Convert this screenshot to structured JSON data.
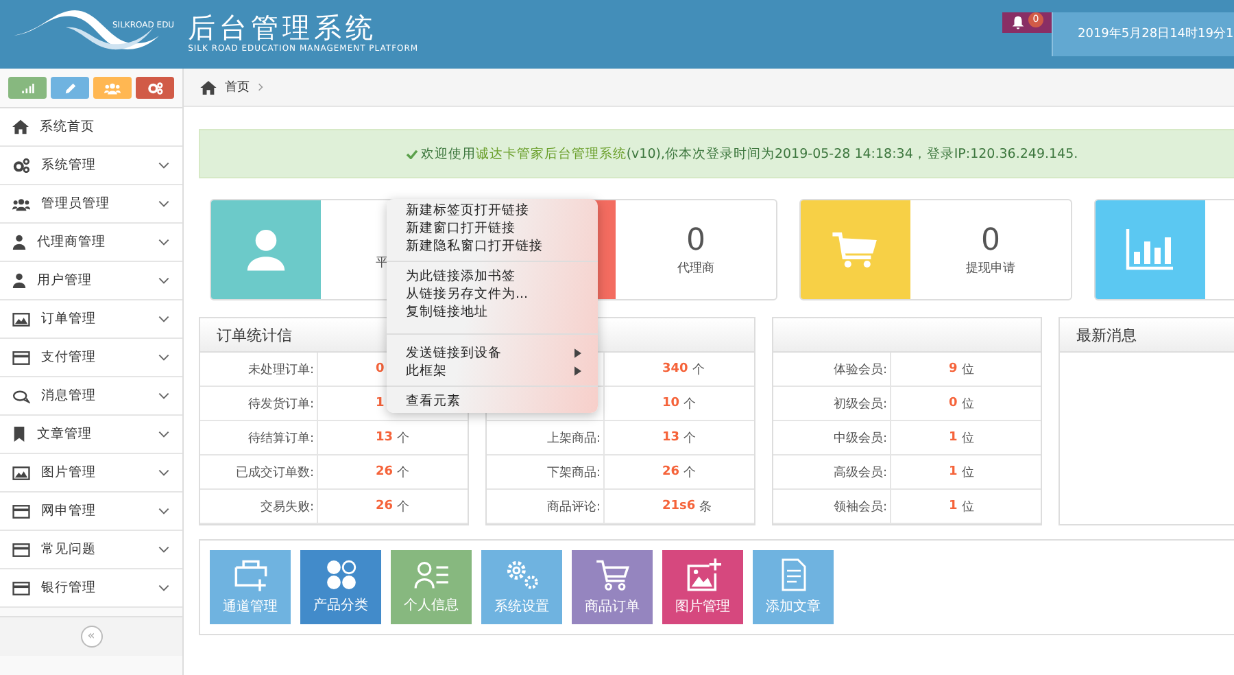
{
  "header": {
    "logo_text": "SILKROAD EDU",
    "title": "后台管理系统",
    "subtitle": "SILK ROAD EDUCATION MANAGEMENT PLATFORM",
    "notifications": "0",
    "datetime": "2019年5月28日14时19分1"
  },
  "sidebar": {
    "shortcuts": [
      {
        "color": "#87b87f"
      },
      {
        "color": "#6fb3e0"
      },
      {
        "color": "#ffb752"
      },
      {
        "color": "#d15b47"
      }
    ],
    "items": [
      {
        "label": "系统首页",
        "expandable": false
      },
      {
        "label": "系统管理",
        "expandable": true
      },
      {
        "label": "管理员管理",
        "expandable": true
      },
      {
        "label": "代理商管理",
        "expandable": true
      },
      {
        "label": "用户管理",
        "expandable": true
      },
      {
        "label": "订单管理",
        "expandable": true
      },
      {
        "label": "支付管理",
        "expandable": true
      },
      {
        "label": "消息管理",
        "expandable": true
      },
      {
        "label": "文章管理",
        "expandable": true
      },
      {
        "label": "图片管理",
        "expandable": true
      },
      {
        "label": "网申管理",
        "expandable": true
      },
      {
        "label": "常见问题",
        "expandable": true
      },
      {
        "label": "银行管理",
        "expandable": true
      }
    ],
    "collapse": "«"
  },
  "breadcrumb": [
    "首页"
  ],
  "welcome": "欢迎使用**诚达卡管家后台管理系统**(v10),你本次登录时间为2019-05-28 14:18:34，登录IP:120.36.249.145.",
  "stat_cards": [
    {
      "color": "#6ccac9",
      "label": "平"
    },
    {
      "color": "#f36c60",
      "value": "0",
      "label": "代理商"
    },
    {
      "color": "#f7d046",
      "value": "0",
      "label": "提现申请"
    },
    {
      "color": "#5bc8f2"
    }
  ],
  "tables": [
    {
      "title": "订单统计信",
      "rows": [
        {
          "label": "未处理订单:",
          "value": "0"
        },
        {
          "label": "待发货订单:",
          "value": "1"
        },
        {
          "label": "待结算订单:",
          "value": "13",
          "unit": "个"
        },
        {
          "label": "已成交订单数:",
          "value": "26",
          "unit": "个"
        },
        {
          "label": "交易失败:",
          "value": "26",
          "unit": "个"
        }
      ]
    },
    {
      "rows": [
        {
          "value": "340",
          "unit": "个"
        },
        {
          "value": "10",
          "unit": "个"
        },
        {
          "label": "上架商品:",
          "value": "13",
          "unit": "个"
        },
        {
          "label": "下架商品:",
          "value": "26",
          "unit": "个"
        },
        {
          "label": "商品评论:",
          "value": "21s6",
          "unit": "条"
        }
      ]
    },
    {
      "rows": [
        {
          "label": "体验会员:",
          "value": "9",
          "unit": "位"
        },
        {
          "label": "初级会员:",
          "value": "0",
          "unit": "位"
        },
        {
          "label": "中级会员:",
          "value": "1",
          "unit": "位"
        },
        {
          "label": "高级会员:",
          "value": "1",
          "unit": "位"
        },
        {
          "label": "领袖会员:",
          "value": "1",
          "unit": "位"
        }
      ]
    }
  ],
  "news": {
    "title": "最新消息"
  },
  "quick_links": [
    {
      "label": "通道管理",
      "color": "#6fb3e0"
    },
    {
      "label": "产品分类",
      "color": "#428bca"
    },
    {
      "label": "个人信息",
      "color": "#87b87f"
    },
    {
      "label": "系统设置",
      "color": "#6fb3e0"
    },
    {
      "label": "商品订单",
      "color": "#9585bf"
    },
    {
      "label": "图片管理",
      "color": "#d6487e"
    },
    {
      "label": "添加文章",
      "color": "#6fb3e0"
    }
  ],
  "context_menu": {
    "groups": [
      [
        {
          "label": "新建标签页打开链接",
          "submenu": false
        },
        {
          "label": "新建窗口打开链接",
          "submenu": false
        },
        {
          "label": "新建隐私窗口打开链接",
          "submenu": false
        }
      ],
      [
        {
          "label": "为此链接添加书签",
          "submenu": false
        },
        {
          "label": "从链接另存文件为...",
          "submenu": false
        },
        {
          "label": "复制链接地址",
          "submenu": false
        }
      ],
      [
        {
          "label": "发送链接到设备",
          "submenu": true
        },
        {
          "label": "此框架",
          "submenu": true
        }
      ],
      [
        {
          "label": "查看元素",
          "submenu": false
        }
      ]
    ]
  }
}
